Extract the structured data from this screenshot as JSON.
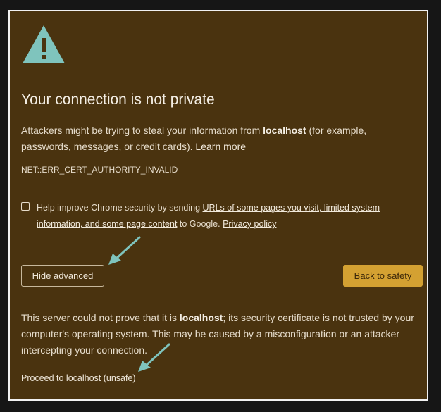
{
  "icon": {
    "name": "warning-triangle-icon",
    "color": "#7fc4bd"
  },
  "title": "Your connection is not private",
  "description": {
    "before": "Attackers might be trying to steal your information from ",
    "host": "localhost",
    "after": " (for example, passwords, messages, or credit cards). ",
    "learn_more": "Learn more"
  },
  "error_code": "NET::ERR_CERT_AUTHORITY_INVALID",
  "help_improve": {
    "before": "Help improve Chrome security by sending ",
    "link1": "URLs of some pages you visit, limited system information, and some page content",
    "middle": " to Google. ",
    "link2": "Privacy policy"
  },
  "buttons": {
    "hide_advanced": "Hide advanced",
    "back_to_safety": "Back to safety"
  },
  "advanced": {
    "before": "This server could not prove that it is ",
    "host": "localhost",
    "after": "; its security certificate is not trusted by your computer's operating system. This may be caused by a misconfiguration or an attacker intercepting your connection."
  },
  "proceed_link": "Proceed to localhost (unsafe)",
  "colors": {
    "background": "#4a330f",
    "accent_button": "#d4a132",
    "annotation_arrow": "#7fc4bd"
  }
}
